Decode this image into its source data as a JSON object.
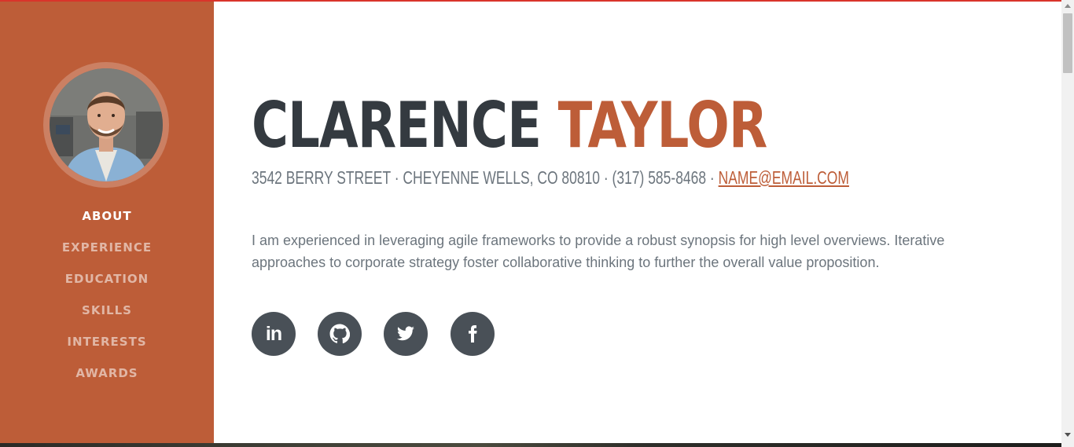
{
  "profile": {
    "first_name": "CLARENCE",
    "last_name": "TAYLOR",
    "address": "3542 BERRY STREET · CHEYENNE WELLS, CO 80810 · (317) 585-8468 · ",
    "email": "NAME@EMAIL.COM",
    "bio": "I am experienced in leveraging agile frameworks to provide a robust synopsis for high level overviews. Iterative approaches to corporate strategy foster collaborative thinking to further the overall value proposition."
  },
  "sidebar": {
    "nav": [
      {
        "label": "ABOUT",
        "active": true
      },
      {
        "label": "EXPERIENCE",
        "active": false
      },
      {
        "label": "EDUCATION",
        "active": false
      },
      {
        "label": "SKILLS",
        "active": false
      },
      {
        "label": "INTERESTS",
        "active": false
      },
      {
        "label": "AWARDS",
        "active": false
      }
    ]
  },
  "social": [
    {
      "icon": "linkedin-icon",
      "glyph": "in"
    },
    {
      "icon": "github-icon"
    },
    {
      "icon": "twitter-icon"
    },
    {
      "icon": "facebook-icon"
    }
  ],
  "colors": {
    "primary": "#bd5d38",
    "heading": "#343a40",
    "text": "#6c757d",
    "social_bg": "#495057",
    "top_line": "#d9342b"
  }
}
